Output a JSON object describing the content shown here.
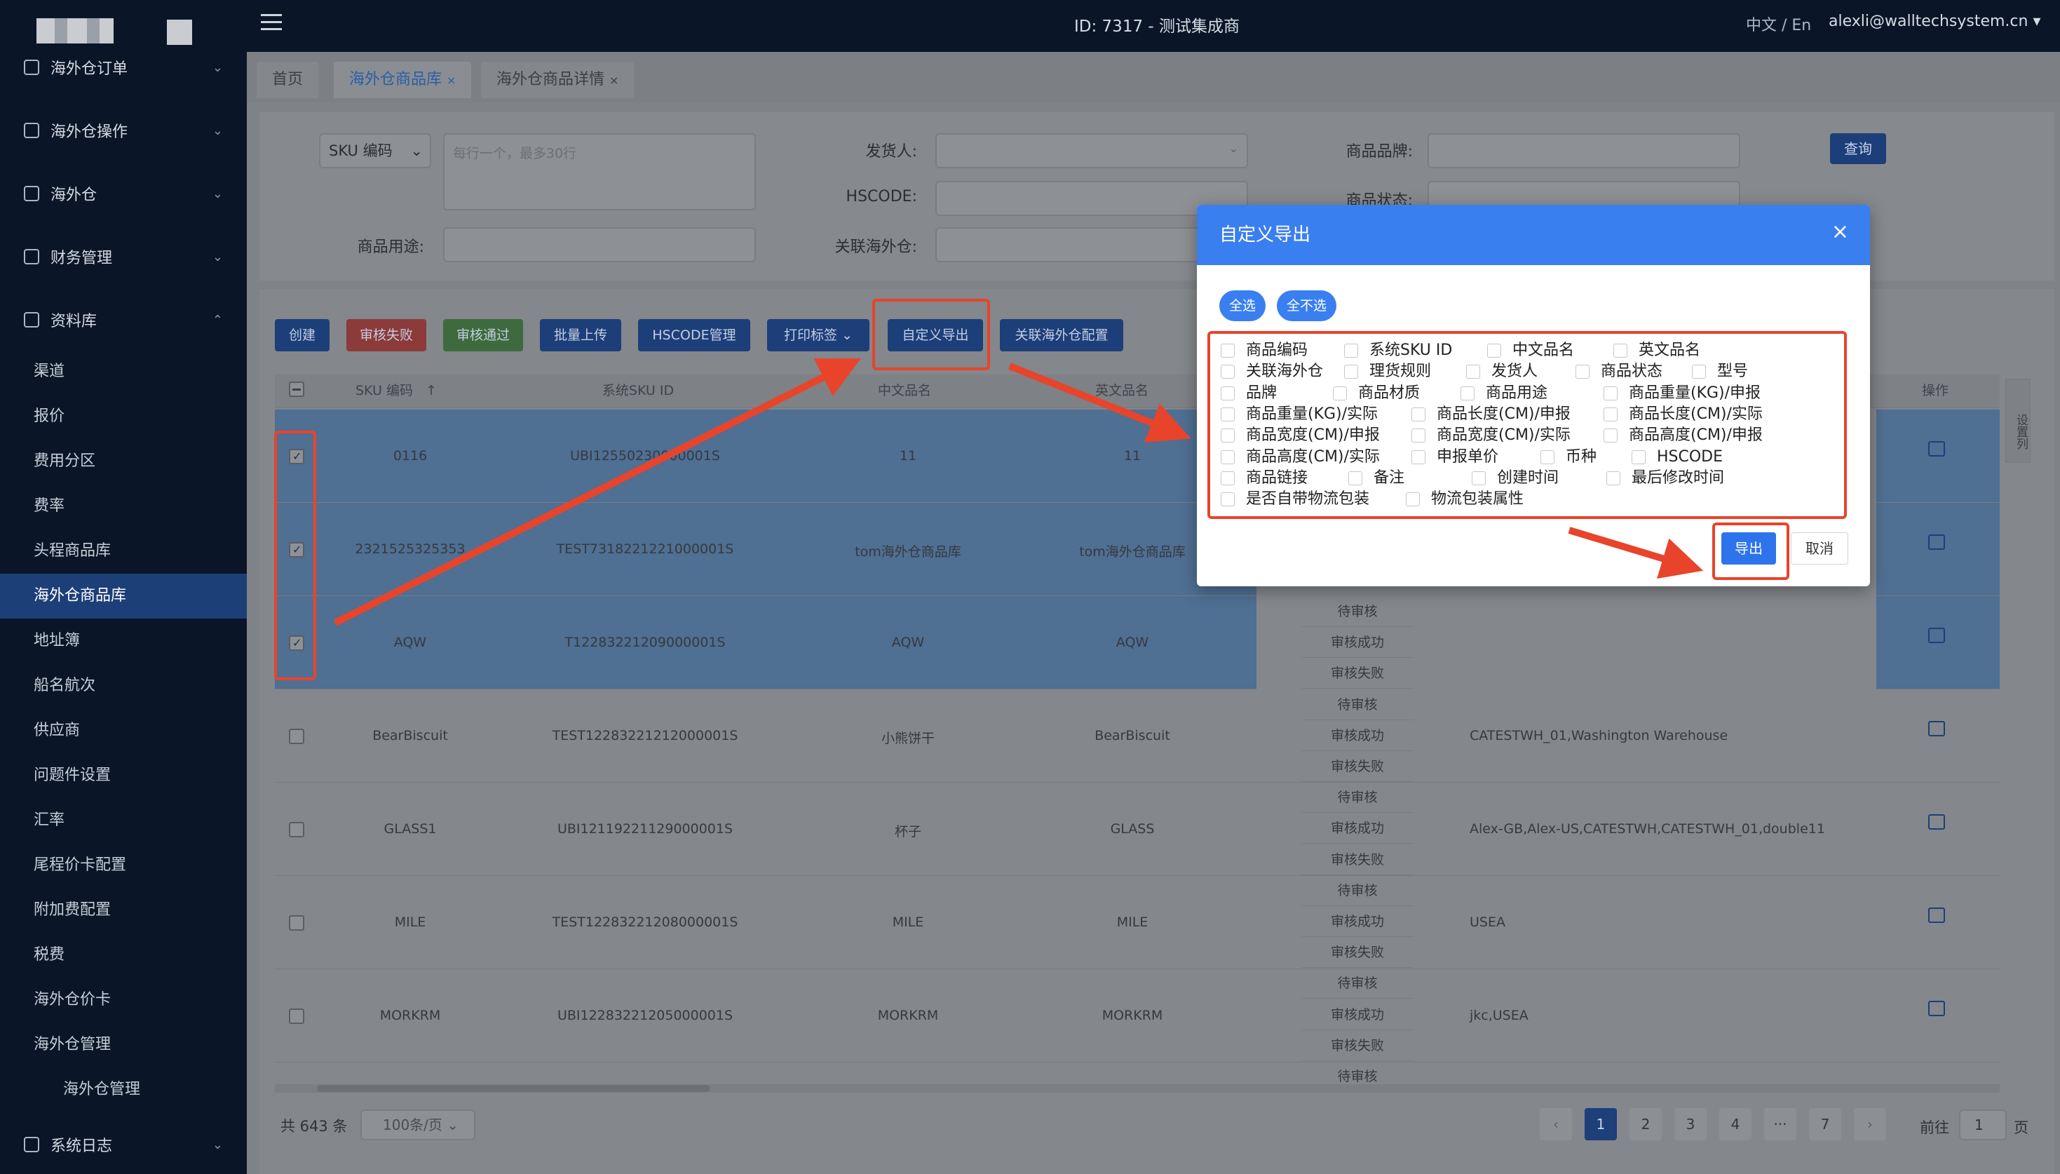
{
  "header": {
    "center_title": "ID: 7317 - 测试集成商",
    "lang": "中文 / En",
    "user": "alexli@walltechsystem.cn"
  },
  "sidebar": {
    "groups": [
      {
        "label": "海外仓订单"
      },
      {
        "label": "海外仓操作"
      },
      {
        "label": "海外仓"
      },
      {
        "label": "财务管理"
      },
      {
        "label": "资料库"
      }
    ],
    "items": [
      "渠道",
      "报价",
      "费用分区",
      "费率",
      "头程商品库",
      "海外仓商品库",
      "地址簿",
      "船名航次",
      "供应商",
      "问题件设置",
      "汇率",
      "尾程价卡配置",
      "附加费配置",
      "税费",
      "海外仓价卡",
      "海外仓管理",
      "海外仓管理"
    ],
    "bottom": "系统日志"
  },
  "tabs": [
    "首页",
    "海外仓商品库",
    "海外仓商品详情"
  ],
  "filters": {
    "sku_select": "SKU 编码",
    "sku_placeholder": "每行一个，最多30行",
    "shipper_label": "发货人:",
    "brand_label": "商品品牌:",
    "hscode_label": "HSCODE:",
    "status_label": "商品状态:",
    "usage_label": "商品用途:",
    "warehouse_label": "关联海外仓:",
    "query_btn": "查询"
  },
  "toolbar": {
    "create": "创建",
    "audit_fail": "审核失败",
    "audit_pass": "审核通过",
    "batch_upload": "批量上传",
    "hscode_mgmt": "HSCODE管理",
    "print_label": "打印标签",
    "custom_export": "自定义导出",
    "warehouse_config": "关联海外仓配置"
  },
  "table": {
    "headers": {
      "sku": "SKU 编码",
      "sku_sort": "↑",
      "sys_sku": "系统SKU ID",
      "cn_name": "中文品名",
      "en_name": "英文品名",
      "op": "操作",
      "settings": "设置列"
    },
    "rows": [
      {
        "sku": "0116",
        "sys_sku": "UBI12550230000001S",
        "cn": "11",
        "en": "11",
        "warehouses": "",
        "checked": true
      },
      {
        "sku": "2321525325353",
        "sys_sku": "TEST7318221221000001S",
        "cn": "tom海外仓商品库",
        "en": "tom海外仓商品库",
        "warehouses": "",
        "checked": true
      },
      {
        "sku": "AQW",
        "sys_sku": "T12283221209000001S",
        "cn": "AQW",
        "en": "AQW",
        "warehouses": "",
        "checked": true
      },
      {
        "sku": "BearBiscuit",
        "sys_sku": "TEST12283221212000001S",
        "cn": "小熊饼干",
        "en": "BearBiscuit",
        "warehouses": "CATESTWH_01,Washington Warehouse",
        "checked": false
      },
      {
        "sku": "GLASS1",
        "sys_sku": "UBI12119221129000001S",
        "cn": "杯子",
        "en": "GLASS",
        "warehouses": "Alex-GB,Alex-US,CATESTWH,CATESTWH_01,double11",
        "checked": false
      },
      {
        "sku": "MILE",
        "sys_sku": "TEST12283221208000001S",
        "cn": "MILE",
        "en": "MILE",
        "warehouses": "USEA",
        "checked": false
      },
      {
        "sku": "MORKRM",
        "sys_sku": "UBI12283221205000001S",
        "cn": "MORKRM",
        "en": "MORKRM",
        "warehouses": "jkc,USEA",
        "checked": false
      }
    ],
    "statuses": [
      "待审核",
      "审核成功",
      "审核失败",
      "待审核",
      "审核成功",
      "审核失败",
      "待审核",
      "审核成功",
      "审核失败",
      "待审核",
      "审核成功",
      "审核失败",
      "待审核",
      "审核成功",
      "审核失败",
      "待审核"
    ]
  },
  "pagination": {
    "total": "共 643 条",
    "page_size": "100条/页",
    "pages": [
      "1",
      "2",
      "3",
      "4",
      "···",
      "7"
    ],
    "current": "1",
    "goto_prefix": "前往",
    "goto_value": "1",
    "goto_suffix": "页"
  },
  "dialog": {
    "title": "自定义导出",
    "select_all": "全选",
    "select_none": "全不选",
    "options": [
      [
        "商品编码",
        "系统SKU ID",
        "中文品名",
        "英文品名"
      ],
      [
        "关联海外仓",
        "理货规则",
        "发货人",
        "商品状态",
        "型号"
      ],
      [
        "品牌",
        "商品材质",
        "商品用途",
        "商品重量(KG)/申报"
      ],
      [
        "商品重量(KG)/实际",
        "商品长度(CM)/申报",
        "商品长度(CM)/实际"
      ],
      [
        "商品宽度(CM)/申报",
        "商品宽度(CM)/实际",
        "商品高度(CM)/申报"
      ],
      [
        "商品高度(CM)/实际",
        "申报单价",
        "币种",
        "HSCODE"
      ],
      [
        "商品链接",
        "备注",
        "创建时间",
        "最后修改时间"
      ],
      [
        "是否自带物流包装",
        "物流包装属性"
      ]
    ],
    "export": "导出",
    "cancel": "取消"
  },
  "colors": {
    "accent": "#3a7ff0",
    "annotation_red": "#e8442b",
    "sidebar_bg": "#0a1628"
  }
}
